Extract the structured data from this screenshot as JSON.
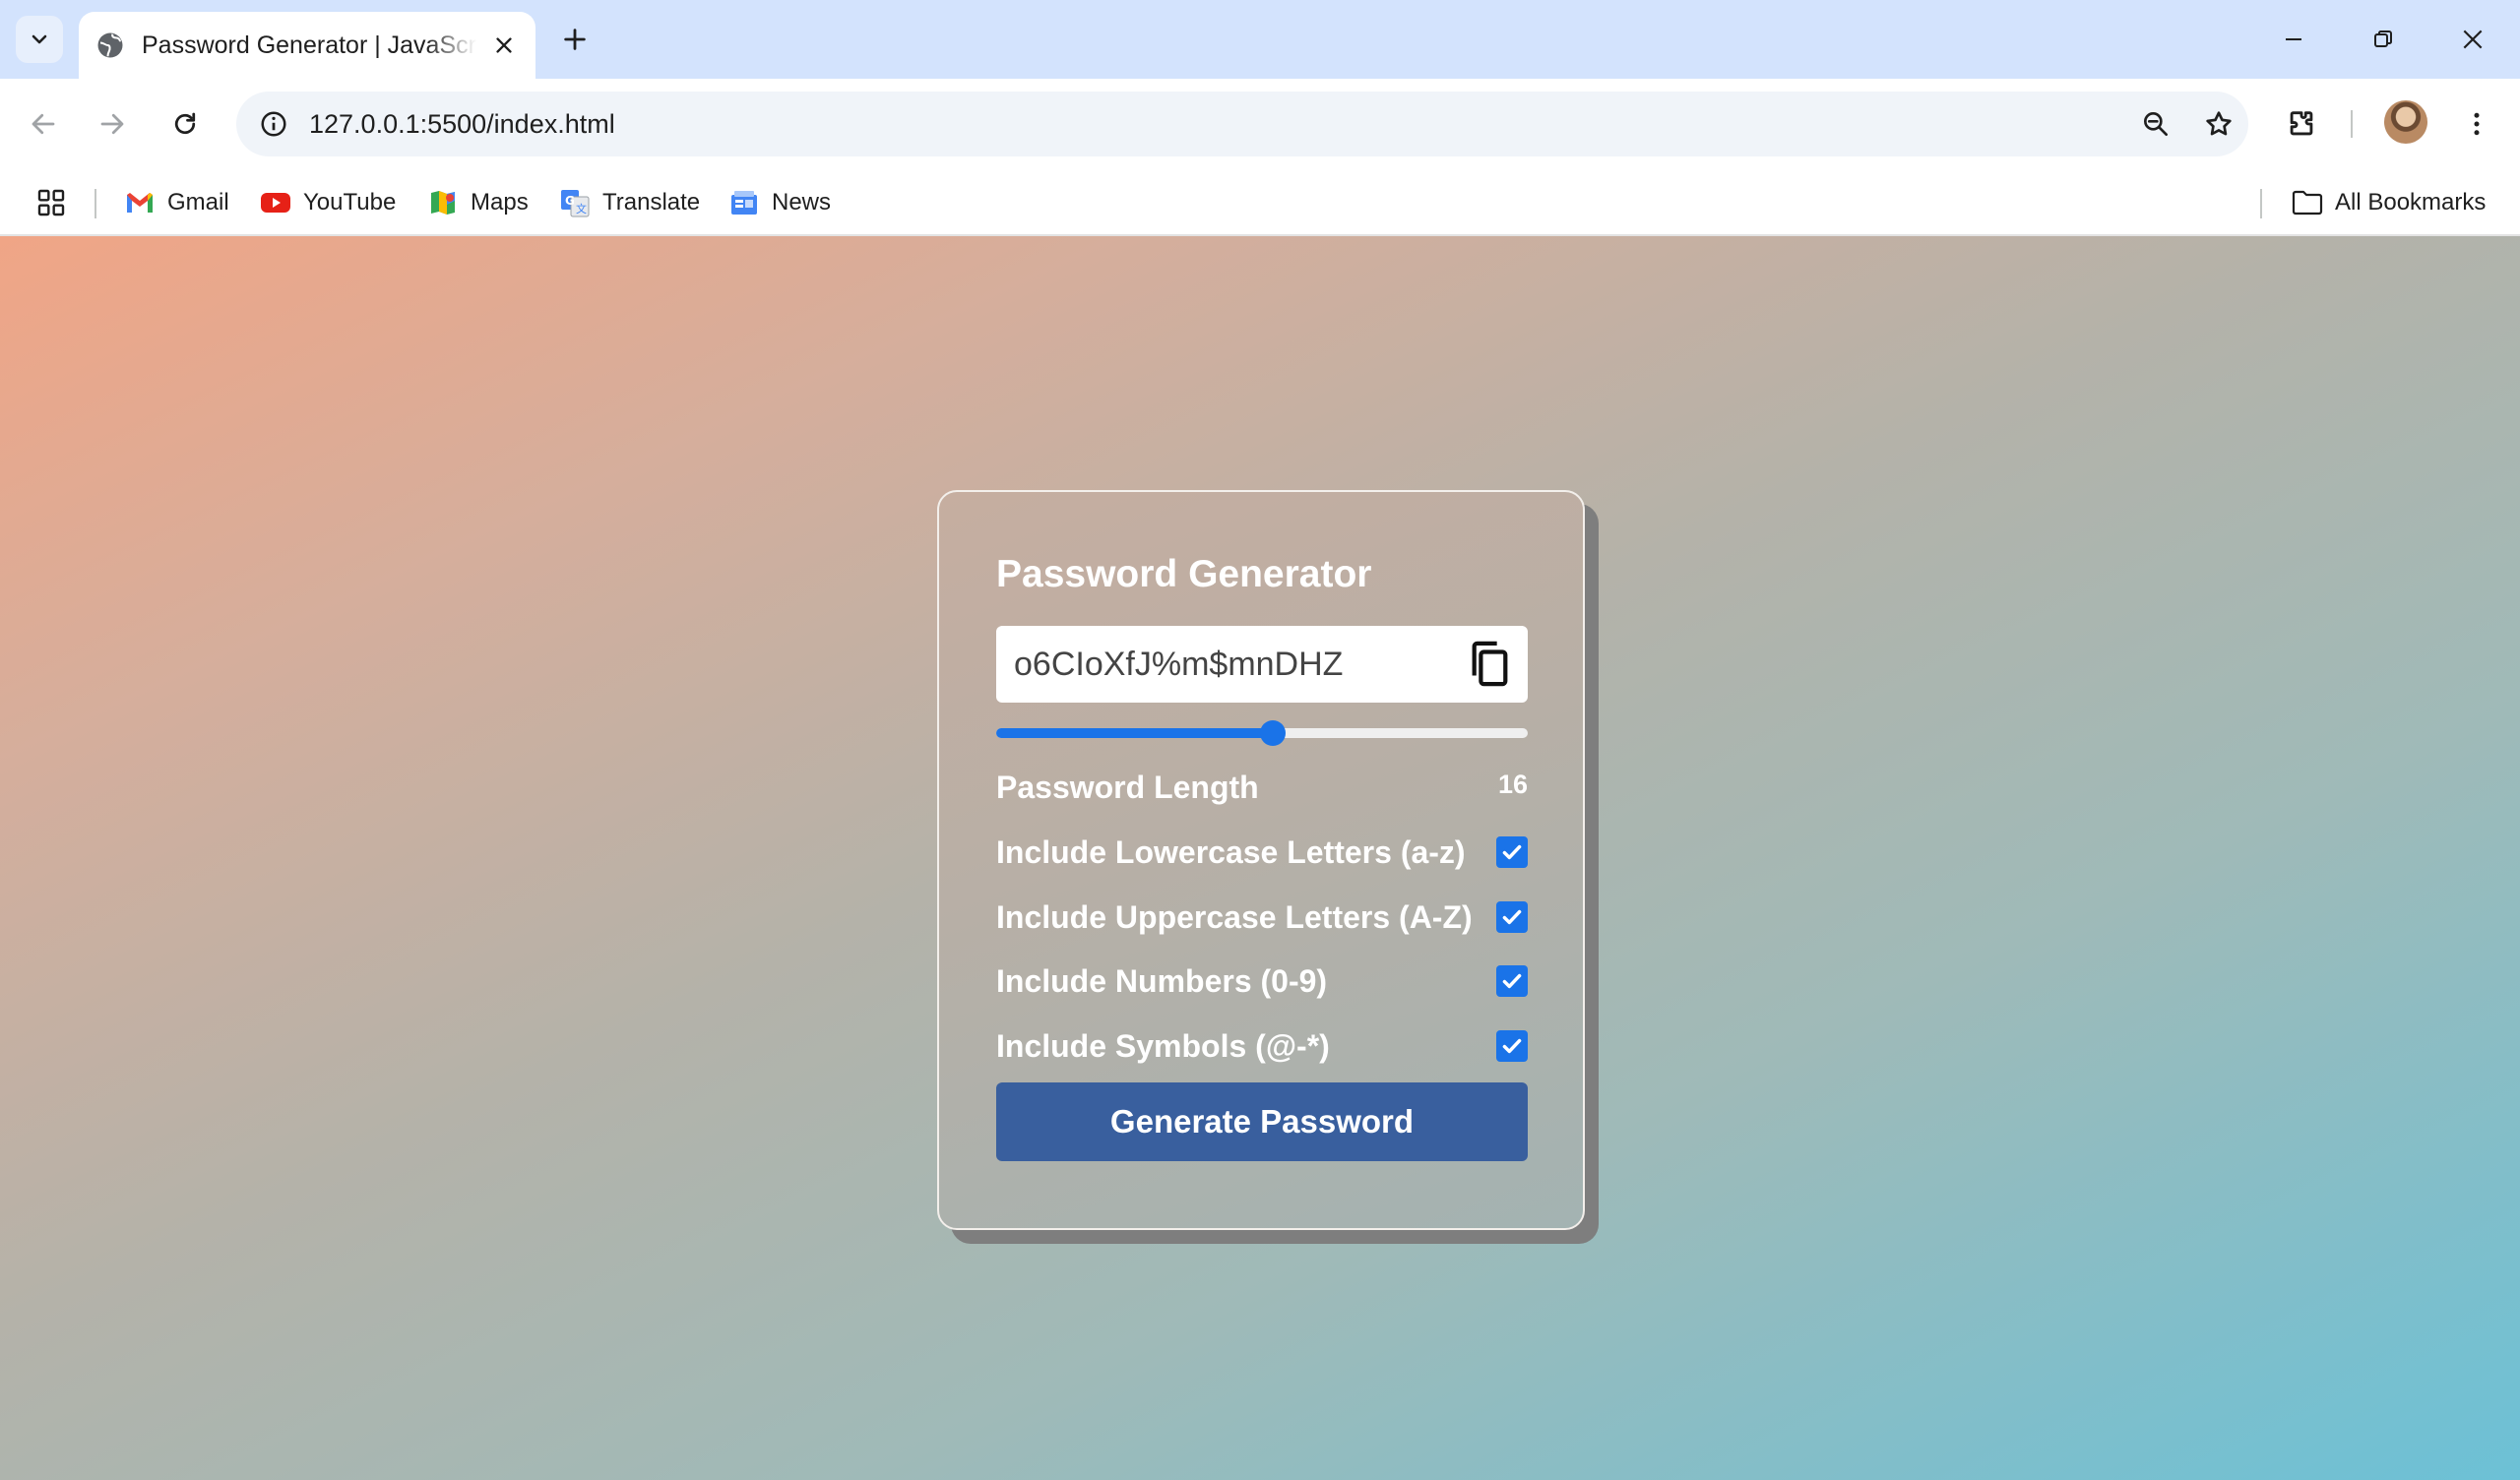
{
  "browser": {
    "tab": {
      "title": "Password Generator | JavaScript",
      "favicon": "globe-icon"
    },
    "address_bar": {
      "url": "127.0.0.1:5500/index.html"
    },
    "bookmarks": [
      {
        "label": "Gmail",
        "icon": "gmail-icon"
      },
      {
        "label": "YouTube",
        "icon": "youtube-icon"
      },
      {
        "label": "Maps",
        "icon": "maps-icon"
      },
      {
        "label": "Translate",
        "icon": "translate-icon"
      },
      {
        "label": "News",
        "icon": "news-icon"
      }
    ],
    "all_bookmarks_label": "All Bookmarks"
  },
  "app": {
    "title": "Password Generator",
    "password": "o6CIoXfJ%m$mnDHZ",
    "length": {
      "label": "Password Length",
      "value": "16",
      "slider_fraction": 0.52
    },
    "options": [
      {
        "label": "Include Lowercase Letters (a-z)",
        "checked": true
      },
      {
        "label": "Include Uppercase Letters (A-Z)",
        "checked": true
      },
      {
        "label": "Include Numbers (0-9)",
        "checked": true
      },
      {
        "label": "Include Symbols (@-*)",
        "checked": true
      }
    ],
    "generate_label": "Generate Password"
  },
  "colors": {
    "accent": "#1a73e8",
    "button": "#395f9e",
    "gradient_start": "#f0a586",
    "gradient_end": "#6cc1d6"
  }
}
